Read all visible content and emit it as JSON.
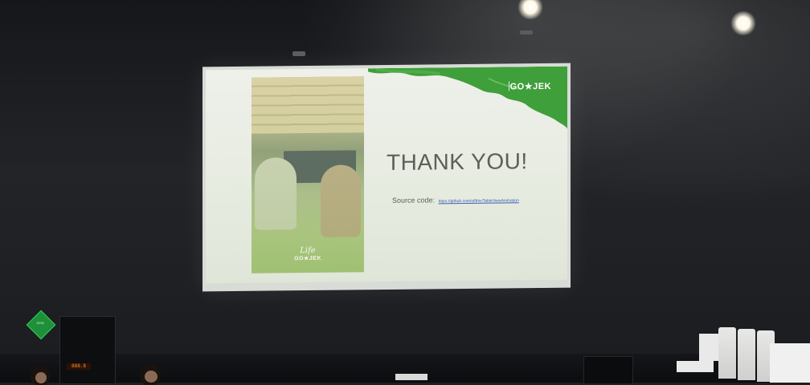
{
  "scene": {
    "description_tags": [
      "presentation-venue",
      "projection-screen"
    ],
    "colors": {
      "brand_green": "#3f9f3a",
      "slide_background": "#eaeee5",
      "title_text": "#5b5f5b",
      "link": "#3a5fb0",
      "room_dark": "#1d1f22"
    }
  },
  "slide": {
    "title": "THANK YOU!",
    "source_label": "Source code:",
    "source_link": "https://github.com/ulfthiv/TableViewAnimation",
    "banner_logo": "GO★JEK",
    "photo_logo_script": "Life",
    "photo_logo_brand": "GO★JEK"
  },
  "room_props": {
    "sign_text": "GYM",
    "rack_display_text": "888.8"
  }
}
